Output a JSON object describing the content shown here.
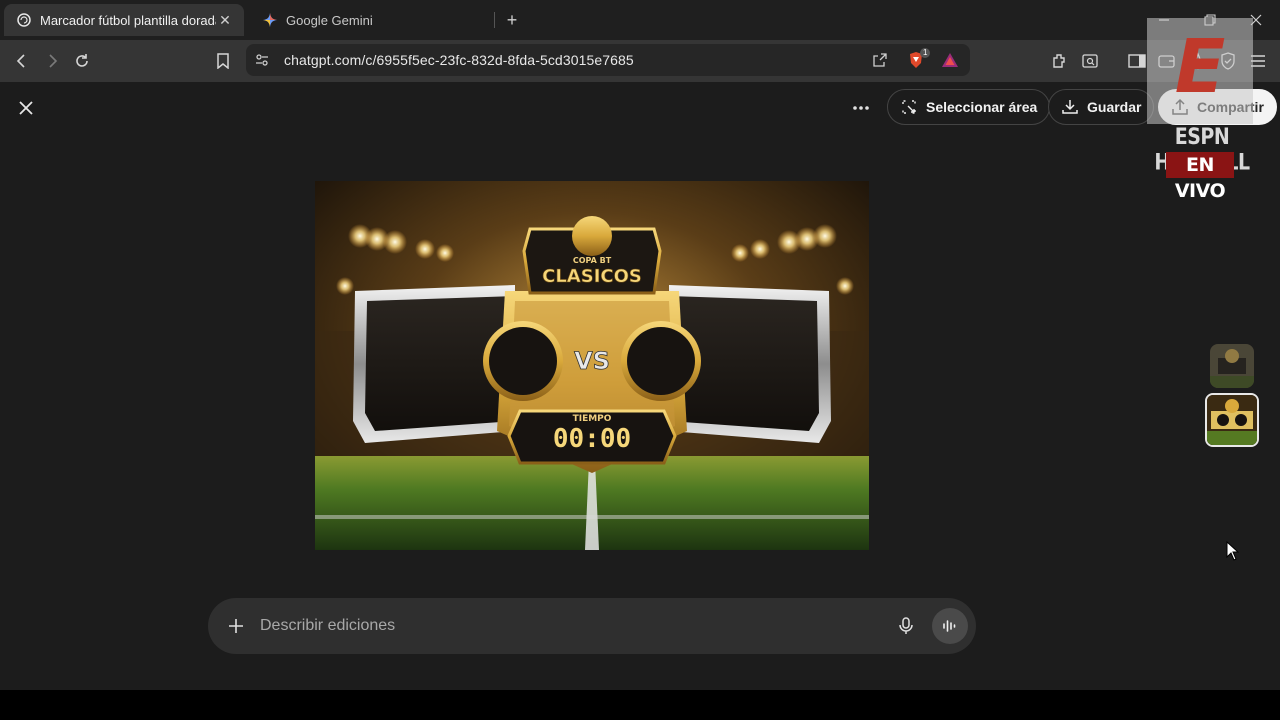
{
  "browser": {
    "tabs": [
      {
        "title": "Marcador fútbol plantilla dorada",
        "favicon": "chatgpt-icon",
        "active": true
      },
      {
        "title": "Google Gemini",
        "favicon": "gemini-icon",
        "active": false
      }
    ],
    "address": {
      "url": "chatgpt.com/c/6955f5ec-23fc-832d-8fda-5cd3015e7685",
      "brave_shield_count": "1"
    }
  },
  "viewer": {
    "actions": {
      "select_area_label": "Seleccionar área",
      "save_label": "Guardar",
      "share_label": "Compartir"
    },
    "image": {
      "cup_line1": "COPA BT",
      "cup_line2": "CLASICOS",
      "vs_text": "VS",
      "timer_label": "TIEMPO",
      "timer_value": "00:00",
      "palette": {
        "gold": "#d9a93b",
        "dark": "#1a1712",
        "silver": "#cfcfcf",
        "grass": "#3d6b1e"
      }
    },
    "thumbnails_count": 2,
    "composer": {
      "placeholder": "Describir ediciones"
    }
  },
  "overlay": {
    "logo_letter": "E",
    "line1": "ESPN HAXBALL",
    "line2": "EN VIVO",
    "accent": "#8a1414"
  }
}
